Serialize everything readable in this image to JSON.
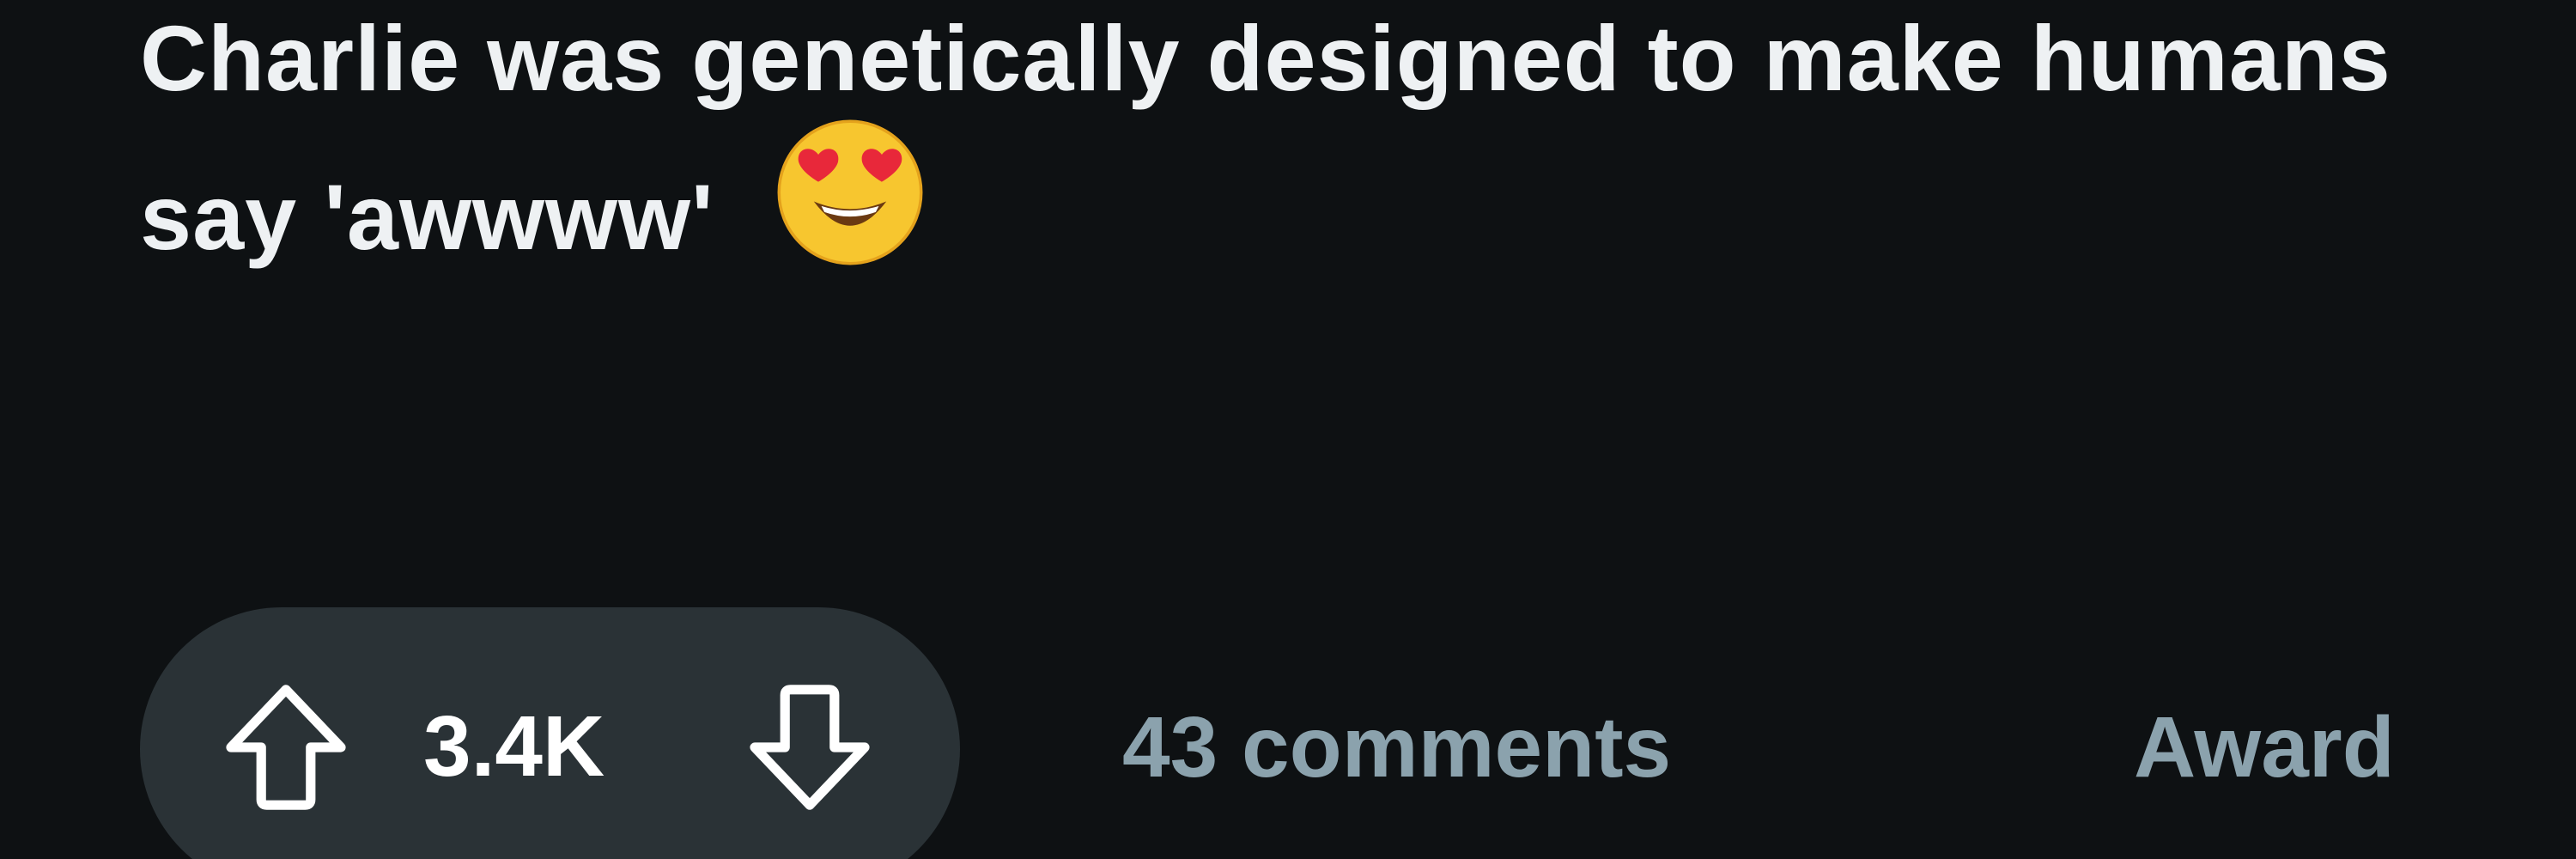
{
  "post": {
    "title": "Charlie was genetically designed to make humans say 'awwww'",
    "title_emoji": "smiling-face-with-heart-eyes-icon"
  },
  "actions": {
    "score": "3.4K",
    "comments": "43 comments",
    "award": "Award",
    "upvote_icon": "arrow-up-outline-icon",
    "downvote_icon": "arrow-down-outline-icon"
  },
  "colors": {
    "background": "#0e1113",
    "title_text": "#eef1f3",
    "pill_background": "#2a3236",
    "secondary_text": "#8ba2ad"
  }
}
